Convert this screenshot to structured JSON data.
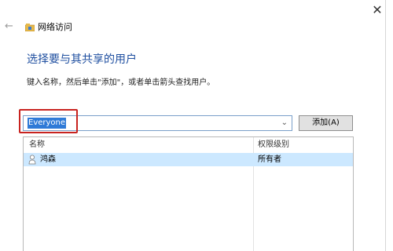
{
  "window": {
    "close_label": "✕",
    "back_icon": "back-arrow-icon",
    "title_icon": "network-share-icon",
    "title": "网络访问"
  },
  "heading": "选择要与其共享的用户",
  "instruction": "键入名称，然后单击\"添加\"，或者单击箭头查找用户。",
  "combo": {
    "value": "Everyone",
    "dropdown_icon": "chevron-down-icon"
  },
  "add_button": "添加(A)",
  "table": {
    "columns": [
      "名称",
      "权限级别"
    ],
    "rows": [
      {
        "name": "鸿森",
        "permission": "所有者",
        "icon": "user-icon",
        "selected": true
      }
    ]
  },
  "colors": {
    "heading": "#1f4fa0",
    "selection": "#2f7ad7",
    "row_selected": "#cce8ff",
    "highlight_box": "#c8231f"
  }
}
